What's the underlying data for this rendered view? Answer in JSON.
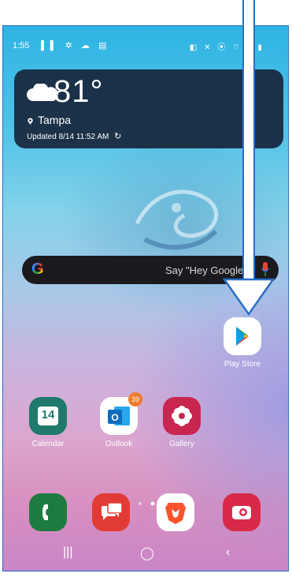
{
  "status_bar": {
    "time": "1:55",
    "left_icons": "▌▌ ✲ ☁ ▤",
    "right_icons": "◧ ✕ ⦿ ⌔ ▮ ▮"
  },
  "weather": {
    "temperature": "81°",
    "city": "Tampa",
    "updated": "Updated 8/14 11:52 AM",
    "icon": "cloud-icon"
  },
  "search_bar": {
    "logo": "G",
    "hint": "Say \"Hey Google\""
  },
  "apps": {
    "play_store": {
      "label": "Play Store"
    },
    "calendar": {
      "label": "Calendar",
      "day": "14"
    },
    "outlook": {
      "label": "Outlook",
      "badge": "39"
    },
    "gallery": {
      "label": "Gallery"
    }
  },
  "dock": [
    "phone-icon",
    "messages-icon",
    "brave-browser-icon",
    "camera-icon"
  ],
  "nav": {
    "recents": "|||",
    "home": "◯",
    "back": "‹"
  },
  "colors": {
    "arrow": "#2a6fc4",
    "calendar": "#1f7a6b",
    "outlook": "#0f6cbd",
    "gallery": "#c8264f",
    "phone": "#1e7b40",
    "messages": "#e23b35",
    "brave": "#ffffff",
    "camera": "#d92948",
    "badge": "#ee7c2b"
  }
}
